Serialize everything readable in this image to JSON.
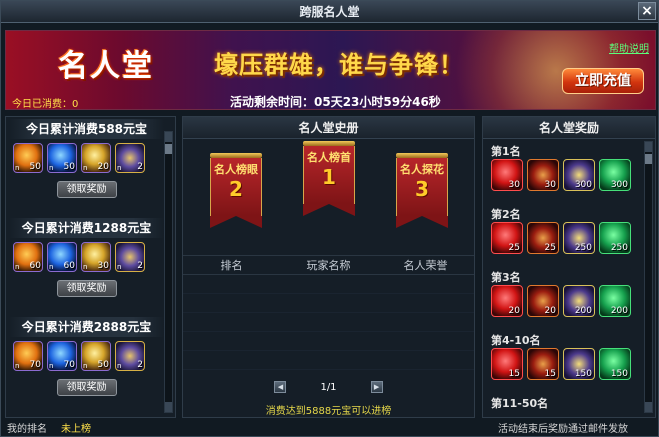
{
  "window": {
    "title": "跨服名人堂",
    "close": "×"
  },
  "banner": {
    "title": "名人堂",
    "slogan": "壕压群雄，谁与争锋！",
    "help": "帮助说明",
    "spent": "今日已消费：0",
    "timer": "活动剩余时间：05天23小时59分46秒",
    "recharge": "立即充值"
  },
  "left": {
    "tiers": [
      {
        "title": "今日累计消费588元宝",
        "qty": [
          "50",
          "50",
          "20",
          "2"
        ],
        "claim": "领取奖励"
      },
      {
        "title": "今日累计消费1288元宝",
        "qty": [
          "60",
          "60",
          "30",
          "2"
        ],
        "claim": "领取奖励"
      },
      {
        "title": "今日累计消费2888元宝",
        "qty": [
          "70",
          "70",
          "50",
          "2"
        ],
        "claim": "领取奖励"
      }
    ]
  },
  "mid": {
    "header": "名人堂史册",
    "flags": [
      {
        "label": "名人榜眼",
        "num": "2"
      },
      {
        "label": "名人榜首",
        "num": "1"
      },
      {
        "label": "名人探花",
        "num": "3"
      }
    ],
    "columns": [
      "排名",
      "玩家名称",
      "名人荣誉"
    ],
    "page": "1/1",
    "note": "消费达到5888元宝可以进榜"
  },
  "right": {
    "header": "名人堂奖励",
    "ranks": [
      {
        "label": "第1名",
        "qty": [
          "30",
          "30",
          "300",
          "300"
        ]
      },
      {
        "label": "第2名",
        "qty": [
          "25",
          "25",
          "250",
          "250"
        ]
      },
      {
        "label": "第3名",
        "qty": [
          "20",
          "20",
          "200",
          "200"
        ]
      },
      {
        "label": "第4-10名",
        "qty": [
          "15",
          "15",
          "150",
          "150"
        ]
      },
      {
        "label": "第11-50名"
      }
    ]
  },
  "footer": {
    "my_rank_label": "我的排名",
    "my_rank_value": "未上榜",
    "notice": "活动结束后奖励通过邮件发放"
  }
}
